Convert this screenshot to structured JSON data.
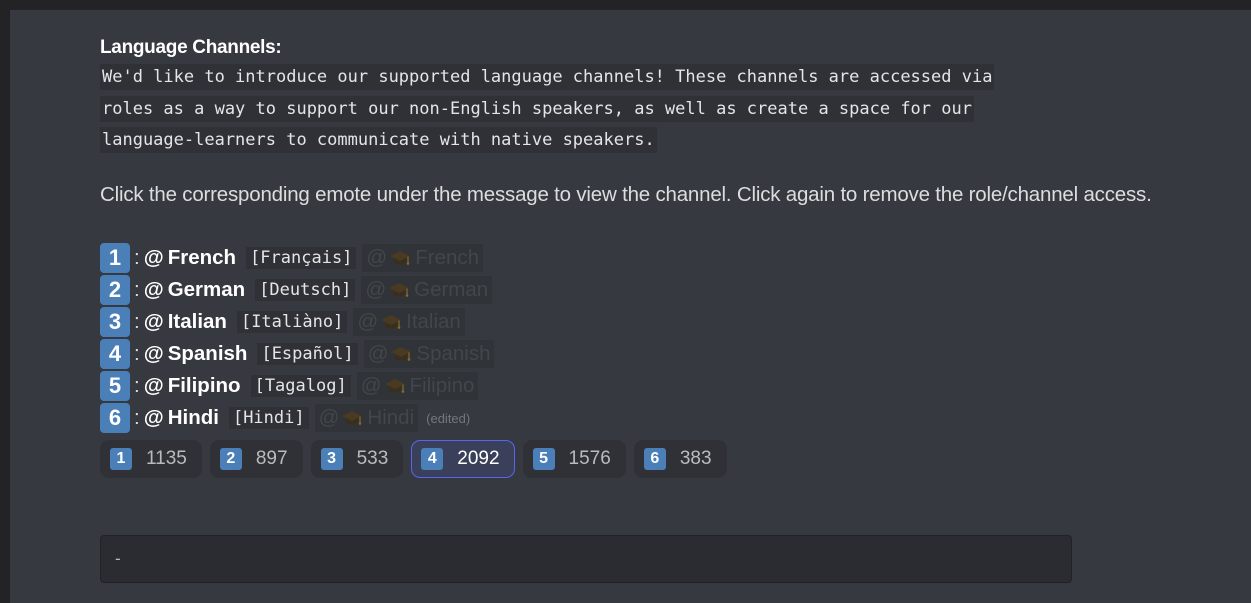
{
  "message": {
    "heading": "Language Channels:",
    "code_lines": [
      "We'd like to introduce our supported language channels! These channels are accessed via",
      "roles as a way to support our non-English speakers, as well as create a space for our",
      "language-learners to communicate with native speakers."
    ],
    "paragraph": "Click the corresponding emote under the message to view the channel. Click again to remove the role/channel access.",
    "roles": [
      {
        "num": "1",
        "name": "French",
        "native": "[Français]",
        "mention": "French"
      },
      {
        "num": "2",
        "name": "German",
        "native": "[Deutsch]",
        "mention": "German"
      },
      {
        "num": "3",
        "name": "Italian",
        "native": "[Italiàno]",
        "mention": "Italian"
      },
      {
        "num": "4",
        "name": "Spanish",
        "native": "[Español]",
        "mention": "Spanish"
      },
      {
        "num": "5",
        "name": "Filipino",
        "native": "[Tagalog]",
        "mention": "Filipino"
      },
      {
        "num": "6",
        "name": "Hindi",
        "native": "[Hindi]",
        "mention": "Hindi"
      }
    ],
    "colon": ":",
    "at": "@",
    "edited": "(edited)"
  },
  "reactions": [
    {
      "emoji": "1",
      "count": "1135",
      "active": false
    },
    {
      "emoji": "2",
      "count": "897",
      "active": false
    },
    {
      "emoji": "3",
      "count": "533",
      "active": false
    },
    {
      "emoji": "4",
      "count": "2092",
      "active": true
    },
    {
      "emoji": "5",
      "count": "1576",
      "active": false
    },
    {
      "emoji": "6",
      "count": "383",
      "active": false
    }
  ],
  "input": {
    "value": "-"
  },
  "colors": {
    "background": "#36393f",
    "badge": "#4a7fb8",
    "reaction_active_border": "#5865f2",
    "code_background": "#2f3136"
  },
  "icons": {
    "role_icon": "graduation-cap-icon"
  }
}
